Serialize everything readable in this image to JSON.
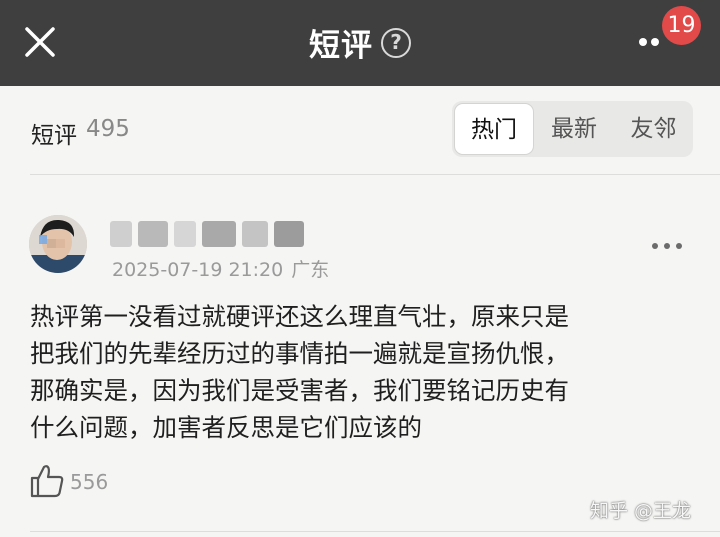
{
  "header": {
    "title": "短评",
    "help_icon": "question-mark-circle-icon",
    "close_icon": "close-x-icon",
    "more_icon": "more-dots-icon",
    "notification_badge": "19",
    "bar_color": "#3f3f3f",
    "badge_color": "#e24a4a"
  },
  "section": {
    "label": "短评",
    "count": "495"
  },
  "tabs": [
    {
      "label": "热门",
      "active": true
    },
    {
      "label": "最新",
      "active": false
    },
    {
      "label": "友邻",
      "active": false
    }
  ],
  "comment": {
    "username_blurred": true,
    "date": "2025-07-19 21:20",
    "location": "广东",
    "lines": [
      "热评第一没看过就硬评还这么理直气壮，原来只是",
      "把我们的先辈经历过的事情拍一遍就是宣扬仇恨，",
      "那确实是，因为我们是受害者，我们要铭记历史有",
      "什么问题，加害者反思是它们应该的"
    ],
    "likes": "556",
    "like_icon": "thumbs-up-icon",
    "more_icon": "more-dots-icon"
  },
  "watermark": "知乎 @王龙"
}
